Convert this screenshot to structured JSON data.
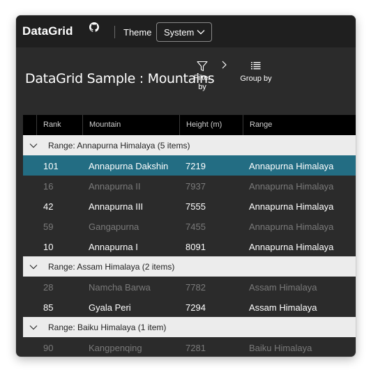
{
  "titlebar": {
    "app_title": "DataGrid",
    "theme_label": "Theme",
    "theme_value": "System"
  },
  "header": {
    "title": "DataGrid Sample : Mountains",
    "filter_label_1": "Filter",
    "filter_label_2": "by",
    "group_label": "Group by"
  },
  "grid": {
    "columns": [
      "Rank",
      "Mountain",
      "Height (m)",
      "Range"
    ],
    "groups": [
      {
        "label": "Range: Annapurna Himalaya (5 items)",
        "rows": [
          {
            "rank": "101",
            "mountain": "Annapurna Dakshin",
            "height": "7219",
            "range": "Annapurna Himalaya",
            "style": "selected"
          },
          {
            "rank": "16",
            "mountain": "Annapurna II",
            "height": "7937",
            "range": "Annapurna Himalaya",
            "style": "dim"
          },
          {
            "rank": "42",
            "mountain": "Annapurna III",
            "height": "7555",
            "range": "Annapurna Himalaya",
            "style": "bright"
          },
          {
            "rank": "59",
            "mountain": "Gangapurna",
            "height": "7455",
            "range": "Annapurna Himalaya",
            "style": "dim"
          },
          {
            "rank": "10",
            "mountain": "Annapurna I",
            "height": "8091",
            "range": "Annapurna Himalaya",
            "style": "bright"
          }
        ]
      },
      {
        "label": "Range: Assam Himalaya (2 items)",
        "rows": [
          {
            "rank": "28",
            "mountain": "Namcha Barwa",
            "height": "7782",
            "range": "Assam Himalaya",
            "style": "dim"
          },
          {
            "rank": "85",
            "mountain": "Gyala Peri",
            "height": "7294",
            "range": "Assam Himalaya",
            "style": "bright"
          }
        ]
      },
      {
        "label": "Range: Baiku Himalaya (1 item)",
        "rows": [
          {
            "rank": "90",
            "mountain": "Kangpenqing",
            "height": "7281",
            "range": "Baiku Himalaya",
            "style": "dim"
          }
        ]
      }
    ]
  },
  "icons": {
    "github": "github-icon",
    "theme_dropdown": "chevron-down-icon",
    "filter": "filter-funnel-icon",
    "breadcrumb": "chevron-right-icon",
    "group": "list-icon",
    "group_toggle": "chevron-down-icon"
  },
  "colors": {
    "selection": "#236d83",
    "group_header_bg": "#ececec",
    "window_bg": "#2b2b2b",
    "titlebar_bg": "#1f1f1f",
    "column_header_bg": "#000000"
  }
}
